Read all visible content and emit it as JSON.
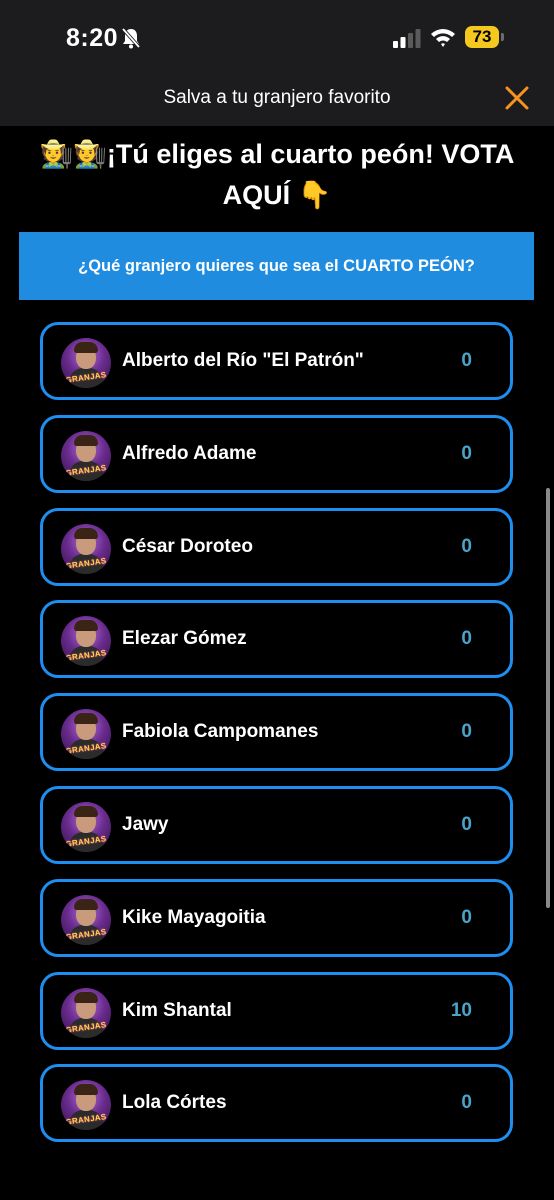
{
  "status_bar": {
    "time": "8:20",
    "battery_level": "73",
    "battery_color": "#f4c81d",
    "icons": [
      "bell-slash-icon",
      "signal-icon",
      "wifi-icon",
      "battery-icon"
    ]
  },
  "header": {
    "title": "Salva a tu granjero favorito",
    "close_icon": "close-icon",
    "accent_color": "#f7931e"
  },
  "hero": {
    "emoji_left": "🧑‍🌾🧑‍🌾",
    "title": "¡Tú eliges al cuarto peón! VOTA AQUÍ",
    "emoji_right": "👇"
  },
  "question": {
    "text": "¿Qué granjero quieres que sea el CUARTO PEÓN?",
    "background_color": "#1f8ce0"
  },
  "candidates": [
    {
      "name": "Alberto del Río \"El Patrón\"",
      "votes": "0",
      "avatar_logo": "GRANJAS"
    },
    {
      "name": "Alfredo Adame",
      "votes": "0",
      "avatar_logo": "GRANJAS"
    },
    {
      "name": "César Doroteo",
      "votes": "0",
      "avatar_logo": "GRANJAS"
    },
    {
      "name": "Elezar Gómez",
      "votes": "0",
      "avatar_logo": "GRANJAS"
    },
    {
      "name": "Fabiola Campomanes",
      "votes": "0",
      "avatar_logo": "GRANJAS"
    },
    {
      "name": "Jawy",
      "votes": "0",
      "avatar_logo": "GRANJAS"
    },
    {
      "name": "Kike Mayagoitia",
      "votes": "0",
      "avatar_logo": "GRANJAS"
    },
    {
      "name": "Kim Shantal",
      "votes": "10",
      "avatar_logo": "GRANJAS"
    },
    {
      "name": "Lola Córtes",
      "votes": "0",
      "avatar_logo": "GRANJAS"
    }
  ],
  "colors": {
    "card_border": "#1e8ef0",
    "vote_count": "#4ba3c9"
  }
}
